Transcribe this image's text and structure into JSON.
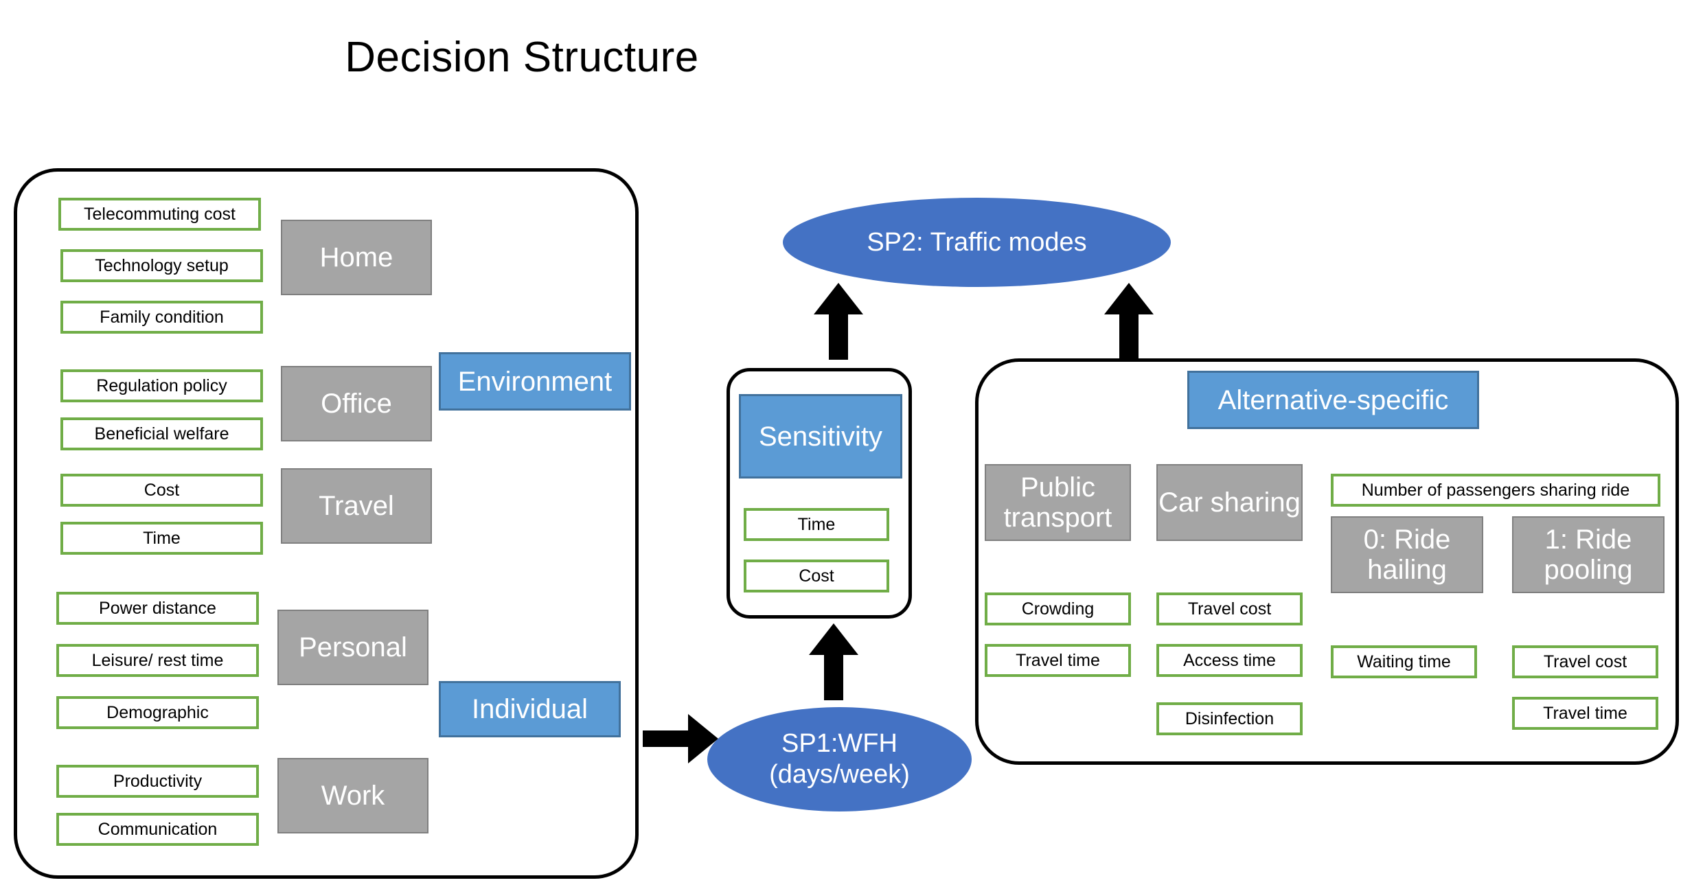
{
  "title": "Decision Structure",
  "colors": {
    "accent_blue_box": "#5B9BD5",
    "accent_blue_ellipse": "#4472C4",
    "gray_box": "#A5A5A5",
    "leaf_border_green": "#70AD47",
    "outline_black": "#000000",
    "text_white": "#FFFFFF",
    "text_black": "#000000"
  },
  "left_panel": {
    "name": "wfh-attributes-panel",
    "categories": [
      {
        "label": "Home",
        "type": "gray",
        "attributes": [
          "Telecommuting cost",
          "Technology setup",
          "Family condition"
        ]
      },
      {
        "label": "Office",
        "type": "gray",
        "attributes": [
          "Regulation policy",
          "Beneficial welfare"
        ]
      },
      {
        "label": "Travel",
        "type": "gray",
        "attributes": [
          "Cost",
          "Time"
        ]
      },
      {
        "label": "Personal",
        "type": "gray",
        "attributes": [
          "Power distance",
          "Leisure/ rest time",
          "Demographic"
        ]
      },
      {
        "label": "Work",
        "type": "gray",
        "attributes": [
          "Productivity",
          "Communication"
        ]
      }
    ],
    "groupings": [
      {
        "label": "Environment",
        "type": "blue"
      },
      {
        "label": "Individual",
        "type": "blue"
      }
    ]
  },
  "middle_panel": {
    "name": "sensitivity-panel",
    "header": {
      "label": "Sensitivity",
      "type": "blue"
    },
    "attributes": [
      "Time",
      "Cost"
    ]
  },
  "right_panel": {
    "name": "alternative-specific-panel",
    "header": {
      "label": "Alternative-specific",
      "type": "blue"
    },
    "columns": [
      {
        "label": "Public transport",
        "type": "gray",
        "attributes": [
          "Crowding",
          "Travel time"
        ]
      },
      {
        "label": "Car sharing",
        "type": "gray",
        "attributes": [
          "Travel cost",
          "Access time",
          "Disinfection"
        ]
      },
      {
        "label": "0: Ride hailing",
        "type": "gray",
        "attributes": [
          "Waiting time"
        ]
      },
      {
        "label": "1: Ride pooling",
        "type": "gray",
        "attributes": [
          "Travel cost",
          "Travel time"
        ]
      }
    ],
    "shared_attribute": "Number of passengers sharing ride"
  },
  "nodes": {
    "sp1": "SP1:WFH\n(days/week)",
    "sp1_line1": "SP1:WFH",
    "sp1_line2": "(days/week)",
    "sp2": "SP2: Traffic modes"
  },
  "arrows": [
    {
      "name": "arrow-left-panel-to-sp1",
      "direction": "right"
    },
    {
      "name": "arrow-sp1-to-sensitivity",
      "direction": "up"
    },
    {
      "name": "arrow-sensitivity-to-sp2",
      "direction": "up"
    },
    {
      "name": "arrow-alternatives-to-sp2",
      "direction": "up"
    }
  ]
}
